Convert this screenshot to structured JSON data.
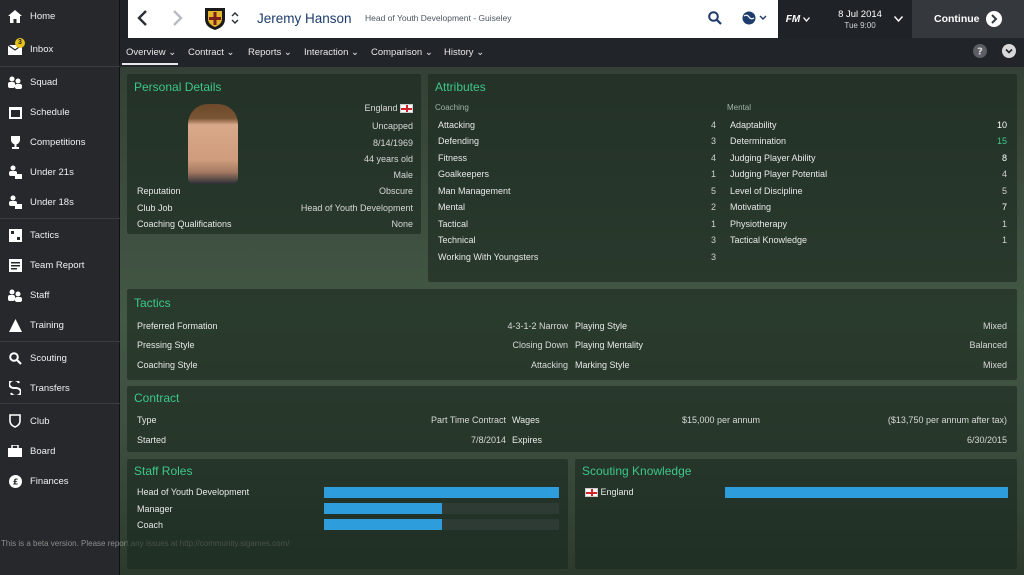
{
  "sidebar": {
    "items": [
      {
        "label": "Home",
        "icon": "home-icon"
      },
      {
        "label": "Inbox",
        "icon": "inbox-icon",
        "badge": "3"
      },
      {
        "label": "Squad",
        "icon": "squad-icon"
      },
      {
        "label": "Schedule",
        "icon": "calendar-icon"
      },
      {
        "label": "Competitions",
        "icon": "trophy-icon"
      },
      {
        "label": "Under 21s",
        "icon": "under21-icon"
      },
      {
        "label": "Under 18s",
        "icon": "under18-icon"
      },
      {
        "label": "Tactics",
        "icon": "tactics-icon"
      },
      {
        "label": "Team Report",
        "icon": "report-icon"
      },
      {
        "label": "Staff",
        "icon": "staff-icon"
      },
      {
        "label": "Training",
        "icon": "training-icon"
      },
      {
        "label": "Scouting",
        "icon": "search-icon"
      },
      {
        "label": "Transfers",
        "icon": "transfers-icon"
      },
      {
        "label": "Club",
        "icon": "club-icon"
      },
      {
        "label": "Board",
        "icon": "board-icon"
      },
      {
        "label": "Finances",
        "icon": "finances-icon"
      }
    ],
    "beta_notice": "This is a beta version. Please report any issues at http://community.sigames.com/"
  },
  "header": {
    "name": "Jeremy Hanson",
    "role": "Head of Youth Development - Guiseley",
    "fm_label": "FM",
    "date": "8 Jul 2014",
    "time": "Tue 9:00",
    "continue_label": "Continue"
  },
  "tabs": [
    "Overview",
    "Contract",
    "Reports",
    "Interaction",
    "Comparison",
    "History"
  ],
  "personal": {
    "title": "Personal Details",
    "nationality": "England",
    "caps": "Uncapped",
    "dob": "8/14/1969",
    "age": "44 years old",
    "gender": "Male",
    "rows": [
      {
        "label": "Reputation",
        "value": "Obscure"
      },
      {
        "label": "Club Job",
        "value": "Head of Youth Development"
      },
      {
        "label": "Coaching Qualifications",
        "value": "None"
      }
    ]
  },
  "attributes": {
    "title": "Attributes",
    "coaching_heading": "Coaching",
    "mental_heading": "Mental",
    "coaching": [
      {
        "label": "Attacking",
        "value": "4"
      },
      {
        "label": "Defending",
        "value": "3"
      },
      {
        "label": "Fitness",
        "value": "4"
      },
      {
        "label": "Goalkeepers",
        "value": "1"
      },
      {
        "label": "Man Management",
        "value": "5"
      },
      {
        "label": "Mental",
        "value": "2"
      },
      {
        "label": "Tactical",
        "value": "1"
      },
      {
        "label": "Technical",
        "value": "3"
      },
      {
        "label": "Working With Youngsters",
        "value": "3"
      }
    ],
    "mental": [
      {
        "label": "Adaptability",
        "value": "10"
      },
      {
        "label": "Determination",
        "value": "15"
      },
      {
        "label": "Judging Player Ability",
        "value": "8"
      },
      {
        "label": "Judging Player Potential",
        "value": "4"
      },
      {
        "label": "Level of Discipline",
        "value": "5"
      },
      {
        "label": "Motivating",
        "value": "7"
      },
      {
        "label": "Physiotherapy",
        "value": "1"
      },
      {
        "label": "Tactical Knowledge",
        "value": "1"
      }
    ]
  },
  "tactics": {
    "title": "Tactics",
    "rows": [
      {
        "label": "Preferred Formation",
        "value": "4-3-1-2 Narrow",
        "label2": "Playing Style",
        "value2": "Mixed"
      },
      {
        "label": "Pressing Style",
        "value": "Closing Down",
        "label2": "Playing Mentality",
        "value2": "Balanced"
      },
      {
        "label": "Coaching Style",
        "value": "Attacking",
        "label2": "Marking Style",
        "value2": "Mixed"
      }
    ]
  },
  "contract": {
    "title": "Contract",
    "type_label": "Type",
    "type_value": "Part Time Contract",
    "wages_label": "Wages",
    "wages_value": "$15,000 per annum",
    "wages_after_tax": "($13,750 per annum after tax)",
    "started_label": "Started",
    "started_value": "7/8/2014",
    "expires_label": "Expires",
    "expires_value": "6/30/2015"
  },
  "staff_roles": {
    "title": "Staff Roles",
    "roles": [
      {
        "label": "Head of Youth Development",
        "level": 1.0
      },
      {
        "label": "Manager",
        "level": 0.5
      },
      {
        "label": "Coach",
        "level": 0.5
      }
    ]
  },
  "scouting": {
    "title": "Scouting Knowledge",
    "items": [
      {
        "label": "England",
        "level": 1.0
      }
    ]
  },
  "colors": {
    "accent_green": "#3ec78a",
    "bar_blue": "#2d9ddb",
    "flag_red": "#d3212c"
  }
}
